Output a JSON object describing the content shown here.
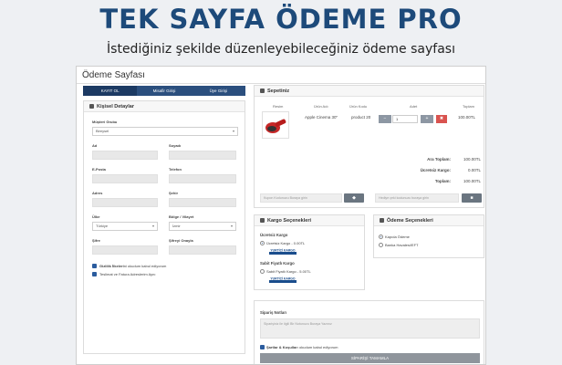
{
  "hero": {
    "title": "TEK SAYFA ÖDEME PRO",
    "subtitle": "İstediğiniz şekilde düzenleyebileceğiniz ödeme sayfası"
  },
  "window": {
    "title": "Ödeme Sayfası"
  },
  "tabs": [
    {
      "label": "KAYIT OL"
    },
    {
      "label": "Misafir Girişi"
    },
    {
      "label": "Üye Girişi"
    }
  ],
  "personal": {
    "title": "Kişisel Detaylar",
    "group_label": "Müşteri Grubu",
    "group_value": "Bireysel",
    "fields": {
      "ad": "Ad",
      "soyadi": "Soyadı",
      "eposta": "E-Posta",
      "telefon": "Telefon",
      "adres": "Adres",
      "sehir": "Şehir",
      "ulke": "Ülke",
      "bolge": "Bölge / Vilayet",
      "sifre": "Şifre",
      "sifre_onay": "Şifreyi Onayla"
    },
    "ulke_value": "Türkiye",
    "bolge_value": "İzmir",
    "privacy_bold": "Gizlilik İlkeleri",
    "privacy_rest": "ni okudum kabul ediyorum",
    "same_address": "Teslimat ve Fatura Adreslerim Aynı"
  },
  "cart": {
    "title": "Sepetiniz",
    "headers": {
      "resim": "Resim",
      "urun_adi": "Ürün Adı",
      "urun_kodu": "Ürün Kodu",
      "adet": "Adet",
      "toplam": "Toplam"
    },
    "item": {
      "name": "Apple Cinema 30\"",
      "code": "product 20",
      "qty": "1",
      "total": "100.00TL"
    },
    "totals": [
      {
        "label": "Ara Toplam:",
        "value": "100.00TL"
      },
      {
        "label": "Ücretsiz Kargo:",
        "value": "0.00TL"
      },
      {
        "label": "Toplam:",
        "value": "100.00TL"
      }
    ],
    "coupon_placeholder": "Kupon Kodunuzu Buraya girin",
    "gift_placeholder": "Hediye çeki kodunuzu buraya girin"
  },
  "shipping": {
    "title": "Kargo Seçenekleri",
    "free_heading": "Ücretsiz Kargo",
    "free_option": "Ücretsiz Kargo - 0.00TL",
    "flat_heading": "Sabit Fiyatlı Kargo",
    "flat_option": "Sabit Fiyatlı Kargo - 5.00TL",
    "logo_text": "YURTİÇİ KARGO"
  },
  "payment": {
    "title": "Ödeme Seçenekleri",
    "options": [
      "Kapıda Ödeme",
      "Banka Havalesi/EFT"
    ]
  },
  "notes": {
    "title": "Sipariş Notları",
    "placeholder": "Siparişiniz ile ilgili Bir Notunuzu Buraya Yazınız"
  },
  "terms": {
    "bold": "Şartlar & Koşullar",
    "rest": "ı okudum kabul ediyorum"
  },
  "submit_label": "SİPARİŞİ TAMAMLA",
  "colors": {
    "accent": "#2b4f7e",
    "hero": "#1d4a7a",
    "danger": "#d9534f"
  }
}
